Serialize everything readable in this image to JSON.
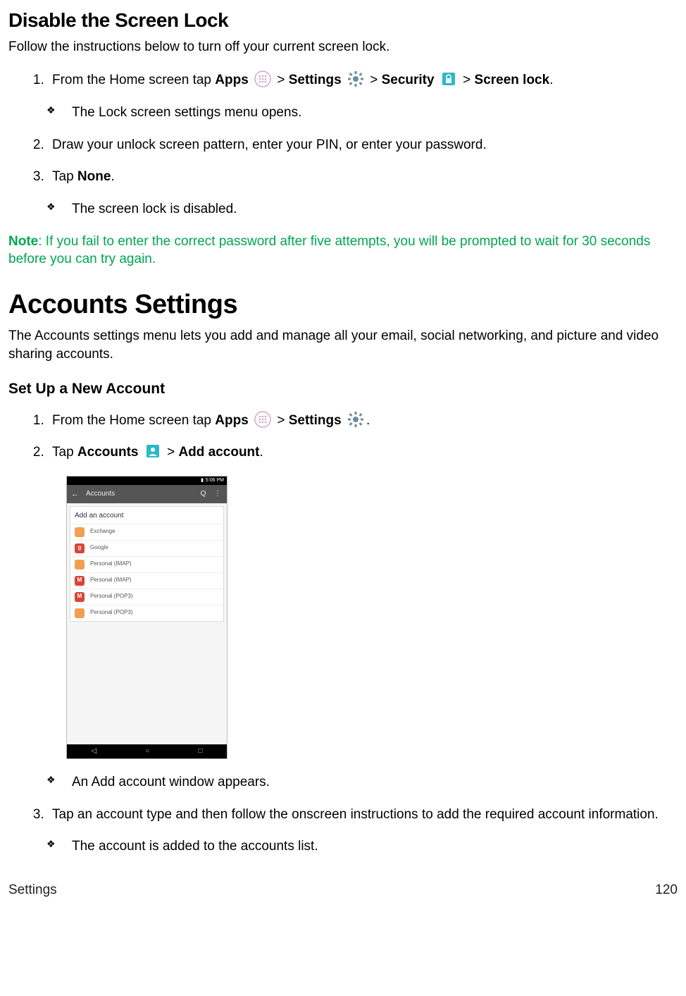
{
  "disable": {
    "title": "Disable the Screen Lock",
    "intro": "Follow the instructions below to turn off your current screen lock.",
    "step1_a": "From the Home screen tap ",
    "apps": "Apps",
    "gt": " > ",
    "settings": "Settings",
    "security": "Security",
    "screenlock": "Screen lock",
    "step1_end": ".",
    "bullet1": "The Lock screen settings menu opens.",
    "step2": "Draw your unlock screen pattern, enter your PIN, or enter your password.",
    "step3_a": "Tap ",
    "none": "None",
    "step3_b": ".",
    "bullet2": "The screen lock is disabled.",
    "note_label": "Note",
    "note_body": ": If you fail to enter the correct password after five attempts, you will be prompted to wait for 30 seconds before you can try again."
  },
  "accounts": {
    "title": "Accounts Settings",
    "intro": "The Accounts settings menu lets you add and manage all your email, social networking, and picture and video sharing accounts.",
    "sub": "Set Up a New Account",
    "step1_a": "From the Home screen tap ",
    "apps": "Apps",
    "settings": "Settings",
    "step1_end": ".",
    "step2_a": "Tap ",
    "accounts_label": "Accounts",
    "addaccount": "Add account",
    "step2_end": ".",
    "bullet1": "An Add account window appears.",
    "step3": "Tap an account type and then follow the onscreen instructions to add the required account information.",
    "bullet2": "The account is added to the accounts list."
  },
  "phone": {
    "time": "5:06 PM",
    "appbar_title": "Accounts",
    "card_title": "Add an account",
    "rows": [
      {
        "color": "#f0a050",
        "txt": "",
        "label": "Exchange"
      },
      {
        "color": "#db4437",
        "txt": "g",
        "label": "Google"
      },
      {
        "color": "#f0a050",
        "txt": "",
        "label": "Personal (IMAP)"
      },
      {
        "color": "#db4437",
        "txt": "M",
        "label": "Personal (IMAP)"
      },
      {
        "color": "#db4437",
        "txt": "M",
        "label": "Personal (POP3)"
      },
      {
        "color": "#f0a050",
        "txt": "",
        "label": "Personal (POP3)"
      }
    ]
  },
  "footer": {
    "left": "Settings",
    "right": "120"
  }
}
